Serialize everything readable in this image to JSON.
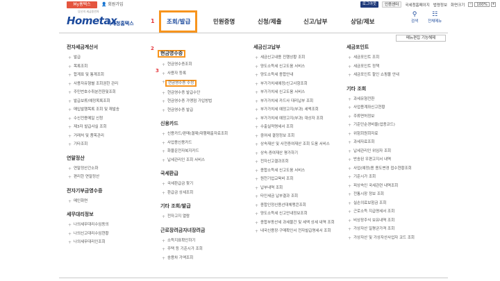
{
  "util": {
    "my_label": "My홈택스",
    "join_label": "회원가입",
    "login_label": "로그아웃",
    "cert_label": "인증센터",
    "links": [
      "국세청홈페이지",
      "법령정보",
      "화면크기"
    ],
    "zoom_value": "100%",
    "zoom_minus": "−",
    "zoom_plus": "+"
  },
  "logo": {
    "main": "Hometax",
    "sub": "국세청홈택스",
    "tag": "당신의 세금동반자"
  },
  "steps": {
    "one": "1",
    "two": "2",
    "three": "3"
  },
  "menu": [
    "조회/발급",
    "민원증명",
    "신청/제출",
    "신고/납부",
    "상담/제보"
  ],
  "search_label": "검색",
  "all_menu_label": "전체메뉴",
  "favorites_label": "메뉴편집 기능해제",
  "col1": {
    "s1_title": "전자세금계산서",
    "s1_items": [
      "발급",
      "목록조회",
      "합계표 및 통계조회",
      "사용자유형별 조회권한 관리",
      "주민번호수취분전환및조회",
      "발급보류/예정목록조회",
      "매입발행목록 조회 및 재발송",
      "수신전용메일 신청",
      "제3자 발급사실 조회",
      "거래처 및 품목관리",
      "기타조회"
    ],
    "s2_title": "연말정산",
    "s2_items": [
      "연말정산간소화",
      "편리한 연말정산"
    ],
    "s3_title": "전자기부금영수증",
    "s3_items": [
      "메인화면"
    ],
    "s4_title": "세무대리정보",
    "s4_items": [
      "나의세무대리수임동의",
      "나의신고대리수임현황",
      "나의세무대리인조회"
    ]
  },
  "col2": {
    "s1_title": "현금영수증",
    "s1_items": [
      "현금영수증조회",
      "사용자 등록",
      "현금영수증 수정",
      "현금영수증 발급수단",
      "현금영수증 가맹점 가입방법",
      "현금영수증 발급"
    ],
    "s2_title": "신용카드",
    "s2_items": [
      "신용카드/판매(결제)대행매출자료조회",
      "사업용신용카드",
      "화물운전자복지카드",
      "납세관리인 조회 서비스"
    ],
    "s3_title": "국세환급",
    "s3_items": [
      "국세환급금 찾기",
      "환급금 상세조회"
    ],
    "s4_title": "기타 조회/발급",
    "s4_items": [
      "전자고지 열람"
    ],
    "s5_title": "근로장려금자녀장려금",
    "s5_items": [
      "소득지표확인하기",
      "주택 등 기준시가 조회",
      "송용차 가액조회"
    ]
  },
  "col3": {
    "s1_title": "세금신고납부",
    "s1_items": [
      "세금신고내용 진행상황 조회",
      "양도소득세 신고도움 서비스",
      "양도소득세 종합안내",
      "부가가치세예정/신고사항조회",
      "부가가치세 신고도움 서비스",
      "부가가치세 카드사 대리납부 조회",
      "부가가치세 예정고지(부과) 세액조회",
      "부가가치세 예정고지(부과) 대상자 조회",
      "수출실적명세서 조회",
      "중여세 결정정보 조회",
      "상속재산 및 사전증여재산 조회 도움 서비스",
      "상속·증여재산 평가하기",
      "전자신고결과조회",
      "종합소득세 신고도움 서비스",
      "원천기업교육비 조회",
      "납부내역 조회",
      "타인세금 납부결과 조회",
      "종합인정신용선대체맹콘조회",
      "양도소득세 신고안내정보조회",
      "종합부동산세 과세물건 및 세액 상세 내역 조회",
      "내국신용장·구매확인서 전자발급명세서 조회"
    ]
  },
  "col4": {
    "s1_title": "세금포인트",
    "s1_items": [
      "세금포인트 조회",
      "세금포인트 정책",
      "세금포인트 할인 쇼핑몰 안내"
    ],
    "s2_title": "기타 조회",
    "s2_items": [
      "과세유형전환",
      "사업용계좌신고현황",
      "주류면허정보",
      "기준단순경비율(업종코드)",
      "위험회원회자료",
      "과세자료조회",
      "납세관리인 위임자 조회",
      "반송된 우편고지서 내역",
      "사업(예정)용 용도변경 접수현황조회",
      "기준시가 조회",
      "피상속인 국세관련 내역조회",
      "전통시장 정보 조회",
      "실손의료보험금 조회",
      "근로소득 지급명세서 조회",
      "비상장주식 보유내역 조회",
      "가상자산 일평균가격 조회",
      "가상자산 및 가상자산사업자 코드 조회"
    ]
  }
}
